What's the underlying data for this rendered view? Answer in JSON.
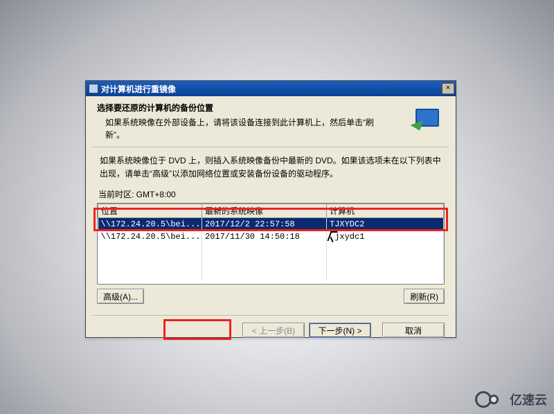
{
  "window": {
    "title": "对计算机进行重镜像",
    "close_glyph": "×"
  },
  "header": {
    "heading": "选择要还原的计算机的备份位置",
    "sub": "如果系统映像在外部设备上，请将该设备连接到此计算机上，然后单击“刷新”。"
  },
  "info": "如果系统映像位于 DVD 上，则插入系统映像备份中最新的 DVD。如果该选项未在以下列表中出现，请单击“高级”以添加网络位置或安装备份设备的驱动程序。",
  "timezone_label": "当前时区: GMT+8:00",
  "table": {
    "headers": [
      "位置",
      "最新的系统映像",
      "计算机"
    ],
    "rows": [
      {
        "location": "\\\\172.24.20.5\\bei...",
        "latest": "2017/12/2 22:57:58",
        "computer": "TJXYDC2",
        "selected": true
      },
      {
        "location": "\\\\172.24.20.5\\bei...",
        "latest": "2017/11/30 14:50:18",
        "computer": "tjxydc1",
        "selected": false
      }
    ]
  },
  "buttons": {
    "advanced": "高级(A)...",
    "refresh": "刷新(R)",
    "back": "< 上一步(B)",
    "next": "下一步(N) >",
    "cancel": "取消"
  },
  "watermark": {
    "text": "亿速云"
  }
}
